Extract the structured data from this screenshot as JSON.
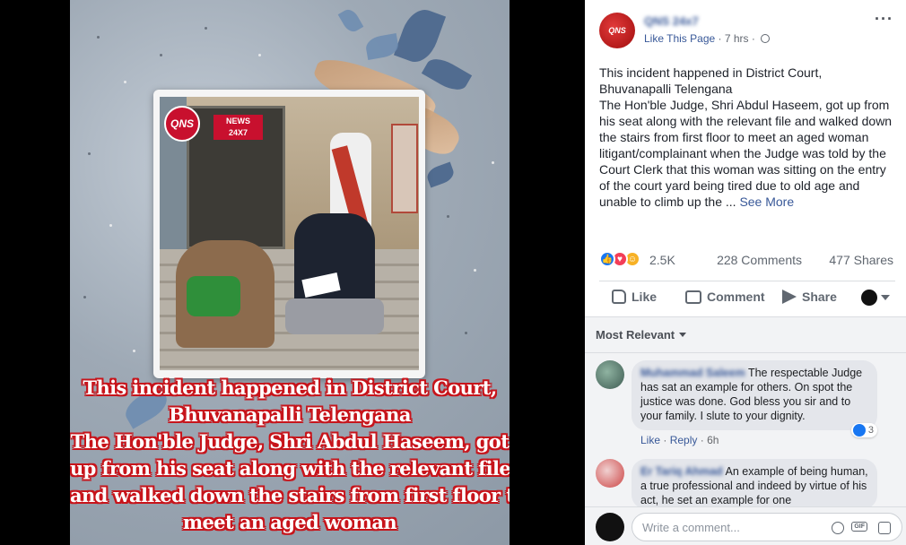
{
  "post": {
    "page_name": "QNS 24x7",
    "logo_text": "QNS",
    "like_page": "Like This Page",
    "time": "7 hrs",
    "text_lines": [
      "This incident happened in District Court,",
      "Bhuvanapalli Telengana",
      "The Hon'ble Judge, Shri Abdul Haseem, got up from his seat along with the relevant file and walked down the stairs from first floor to meet an aged woman litigant/complainant when the Judge was told by the Court Clerk that this woman was sitting on the entry of the court yard being tired due to old age and unable to climb up the ..."
    ],
    "see_more": "See More",
    "reaction_count": "2.5K",
    "comment_count": "228 Comments",
    "share_count": "477 Shares"
  },
  "image": {
    "logo": "QNS",
    "news_tag_top": "NEWS",
    "news_tag_bottom": "24X7",
    "caption_lines": [
      "This incident happened  in District Court,",
      "Bhuvanapalli Telengana",
      "The Hon'ble Judge, Shri Abdul Haseem,  got",
      "up from his seat along with the relevant file",
      "and walked down the stairs from first floor to",
      "meet an aged woman"
    ]
  },
  "actions": {
    "like": "Like",
    "comment": "Comment",
    "share": "Share"
  },
  "comments": {
    "sort_label": "Most Relevant",
    "items": [
      {
        "name": "Muhammad Saleem",
        "text": "The respectable Judge has sat an example for others. On spot the justice was done. God bless you sir and to your family. I slute to your dignity.",
        "like": "Like",
        "reply": "Reply",
        "time": "6h",
        "reactions": "3"
      },
      {
        "name": "Er Tariq Ahmad",
        "text": "An example of being human, a true professional and indeed by virtue of his act, he set an example for one"
      }
    ],
    "composer_placeholder": "Write a comment...",
    "gif": "GIF"
  },
  "icons": {
    "globe": "globe-icon",
    "more": "more-options-icon",
    "like": "thumbs-up-icon",
    "comment": "comment-bubble-icon",
    "share": "share-arrow-icon",
    "emoji": "emoji-icon",
    "gif": "gif-icon",
    "sticker": "sticker-icon"
  },
  "colors": {
    "link": "#385898",
    "like_blue": "#1877f2",
    "caption_outline": "#c7141b",
    "brand_red": "#c8102e"
  }
}
